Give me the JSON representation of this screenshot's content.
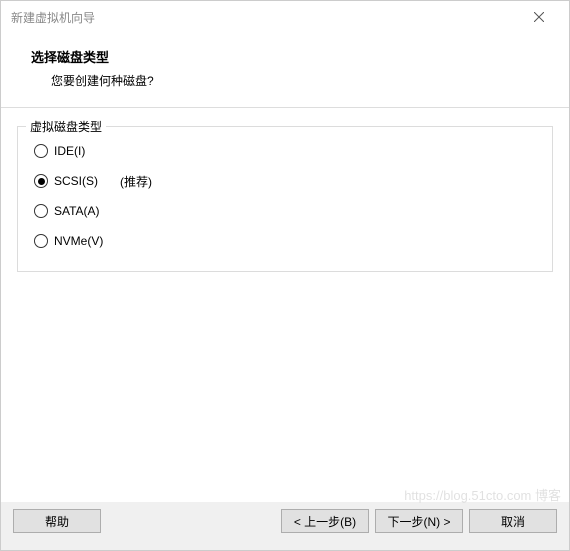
{
  "window": {
    "title": "新建虚拟机向导"
  },
  "header": {
    "heading": "选择磁盘类型",
    "subheading": "您要创建何种磁盘?"
  },
  "group": {
    "label": "虚拟磁盘类型",
    "options": [
      {
        "label": "IDE(I)",
        "selected": false,
        "note": ""
      },
      {
        "label": "SCSI(S)",
        "selected": true,
        "note": "(推荐)"
      },
      {
        "label": "SATA(A)",
        "selected": false,
        "note": ""
      },
      {
        "label": "NVMe(V)",
        "selected": false,
        "note": ""
      }
    ]
  },
  "footer": {
    "help": "帮助",
    "back": "< 上一步(B)",
    "next": "下一步(N) >",
    "cancel": "取消"
  },
  "watermark": "https://blog.51cto.com 博客"
}
